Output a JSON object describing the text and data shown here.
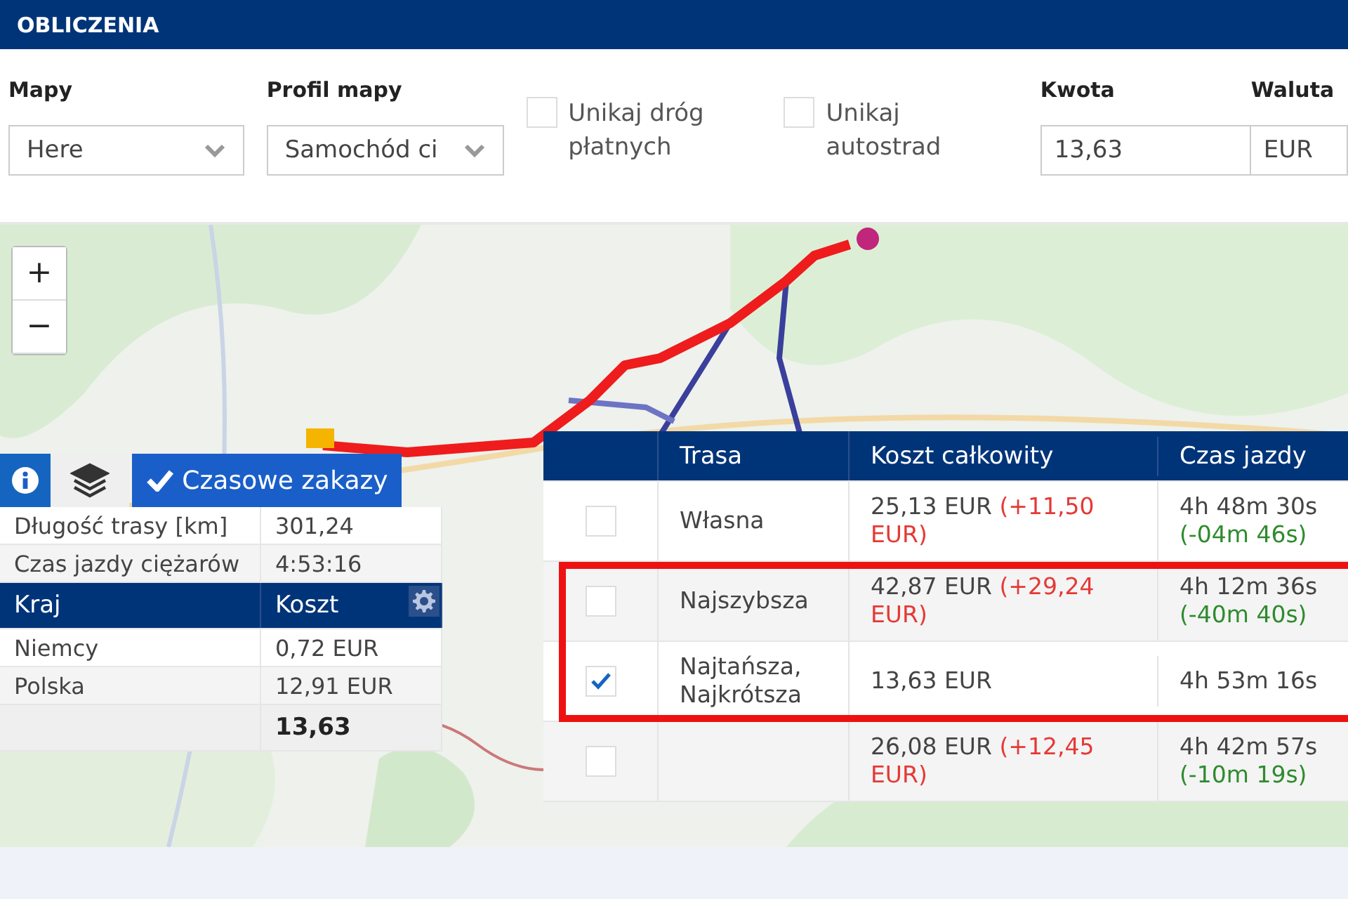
{
  "header": {
    "title": "OBLICZENIA"
  },
  "form": {
    "map_select": {
      "label": "Mapy",
      "value": "Here"
    },
    "profile_select": {
      "label": "Profil mapy",
      "value": "Samochód ci"
    },
    "options": [
      {
        "label": "Unikaj dróg płatnych",
        "checked": false
      },
      {
        "label": "Unikaj autostrad",
        "checked": false
      }
    ],
    "amount": {
      "label": "Kwota",
      "value": "13,63"
    },
    "currency": {
      "label": "Waluta",
      "value": "EUR"
    }
  },
  "map": {
    "kind": "picture",
    "zoom_in": "+",
    "zoom_out": "−"
  },
  "summary": {
    "tabs": [
      {
        "kind": "info",
        "selected": true
      },
      {
        "kind": "layers",
        "selected": false
      },
      {
        "kind": "toggle",
        "label": "Czasowe zakazy",
        "checked": true
      }
    ],
    "facts": [
      {
        "label": "Długość trasy [km]",
        "value": "301,24"
      },
      {
        "label": "Czas jazdy ciężarów",
        "value": "4:53:16"
      }
    ],
    "columns": [
      "Kraj",
      "Koszt"
    ],
    "rows": [
      {
        "country": "Niemcy",
        "cost": "0,72 EUR"
      },
      {
        "country": "Polska",
        "cost": "12,91 EUR"
      }
    ],
    "total": "13,63"
  },
  "routes": {
    "columns": [
      "Trasa",
      "Koszt całkowity",
      "Czas jazdy"
    ],
    "rows": [
      {
        "name": "Własna",
        "cost": "25,13 EUR",
        "cost_diff": "(+11,50 EUR)",
        "time": "4h 48m 30s",
        "time_diff": "(-04m 46s)",
        "checked": false,
        "highlighted": false
      },
      {
        "name": "Najszybsza",
        "cost": "42,87 EUR",
        "cost_diff": "(+29,24 EUR)",
        "time": "4h 12m 36s",
        "time_diff": "(-40m 40s)",
        "checked": false,
        "highlighted": true
      },
      {
        "name": "Najtańsza, Najkrótsza",
        "cost": "13,63 EUR",
        "time": "4h 53m 16s",
        "checked": true,
        "highlighted": true
      },
      {
        "cost": "26,08 EUR",
        "cost_diff": "(+12,45 EUR)",
        "time": "4h 42m 57s",
        "time_diff": "(-10m 19s)",
        "checked": false,
        "highlighted": false
      }
    ]
  }
}
